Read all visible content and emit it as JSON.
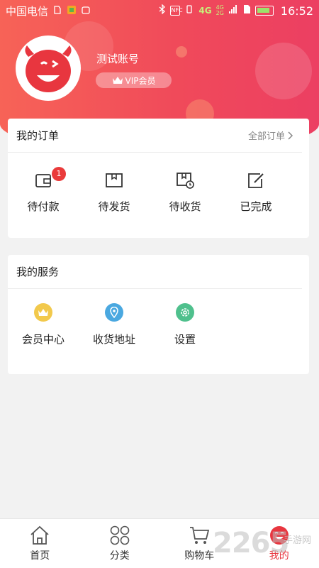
{
  "status_bar": {
    "carrier": "中国电信",
    "network": "4G",
    "network2": "4G",
    "network3": "2G",
    "nfc": "NFC",
    "time": "16:52"
  },
  "profile": {
    "username": "测试账号",
    "vip_label": "VIP会员"
  },
  "orders": {
    "title": "我的订单",
    "all_link": "全部订单",
    "items": [
      {
        "label": "待付款",
        "icon": "wallet-icon",
        "badge": "1"
      },
      {
        "label": "待发货",
        "icon": "box-icon"
      },
      {
        "label": "待收货",
        "icon": "delivery-icon"
      },
      {
        "label": "已完成",
        "icon": "edit-icon"
      }
    ]
  },
  "services": {
    "title": "我的服务",
    "items": [
      {
        "label": "会员中心",
        "icon": "crown-icon",
        "color": "#f2c94c"
      },
      {
        "label": "收货地址",
        "icon": "location-icon",
        "color": "#4aa8e0"
      },
      {
        "label": "设置",
        "icon": "gear-icon",
        "color": "#4fc08d"
      }
    ]
  },
  "tabbar": {
    "items": [
      {
        "label": "首页",
        "icon": "home-icon"
      },
      {
        "label": "分类",
        "icon": "grid-icon"
      },
      {
        "label": "购物车",
        "icon": "cart-icon"
      },
      {
        "label": "我的",
        "icon": "profile-icon",
        "active": true
      }
    ]
  },
  "watermark": {
    "text": "2265",
    "sub": "手游网"
  },
  "colors": {
    "accent": "#e8363f",
    "header_start": "#f76357",
    "header_end": "#ec3f62"
  }
}
